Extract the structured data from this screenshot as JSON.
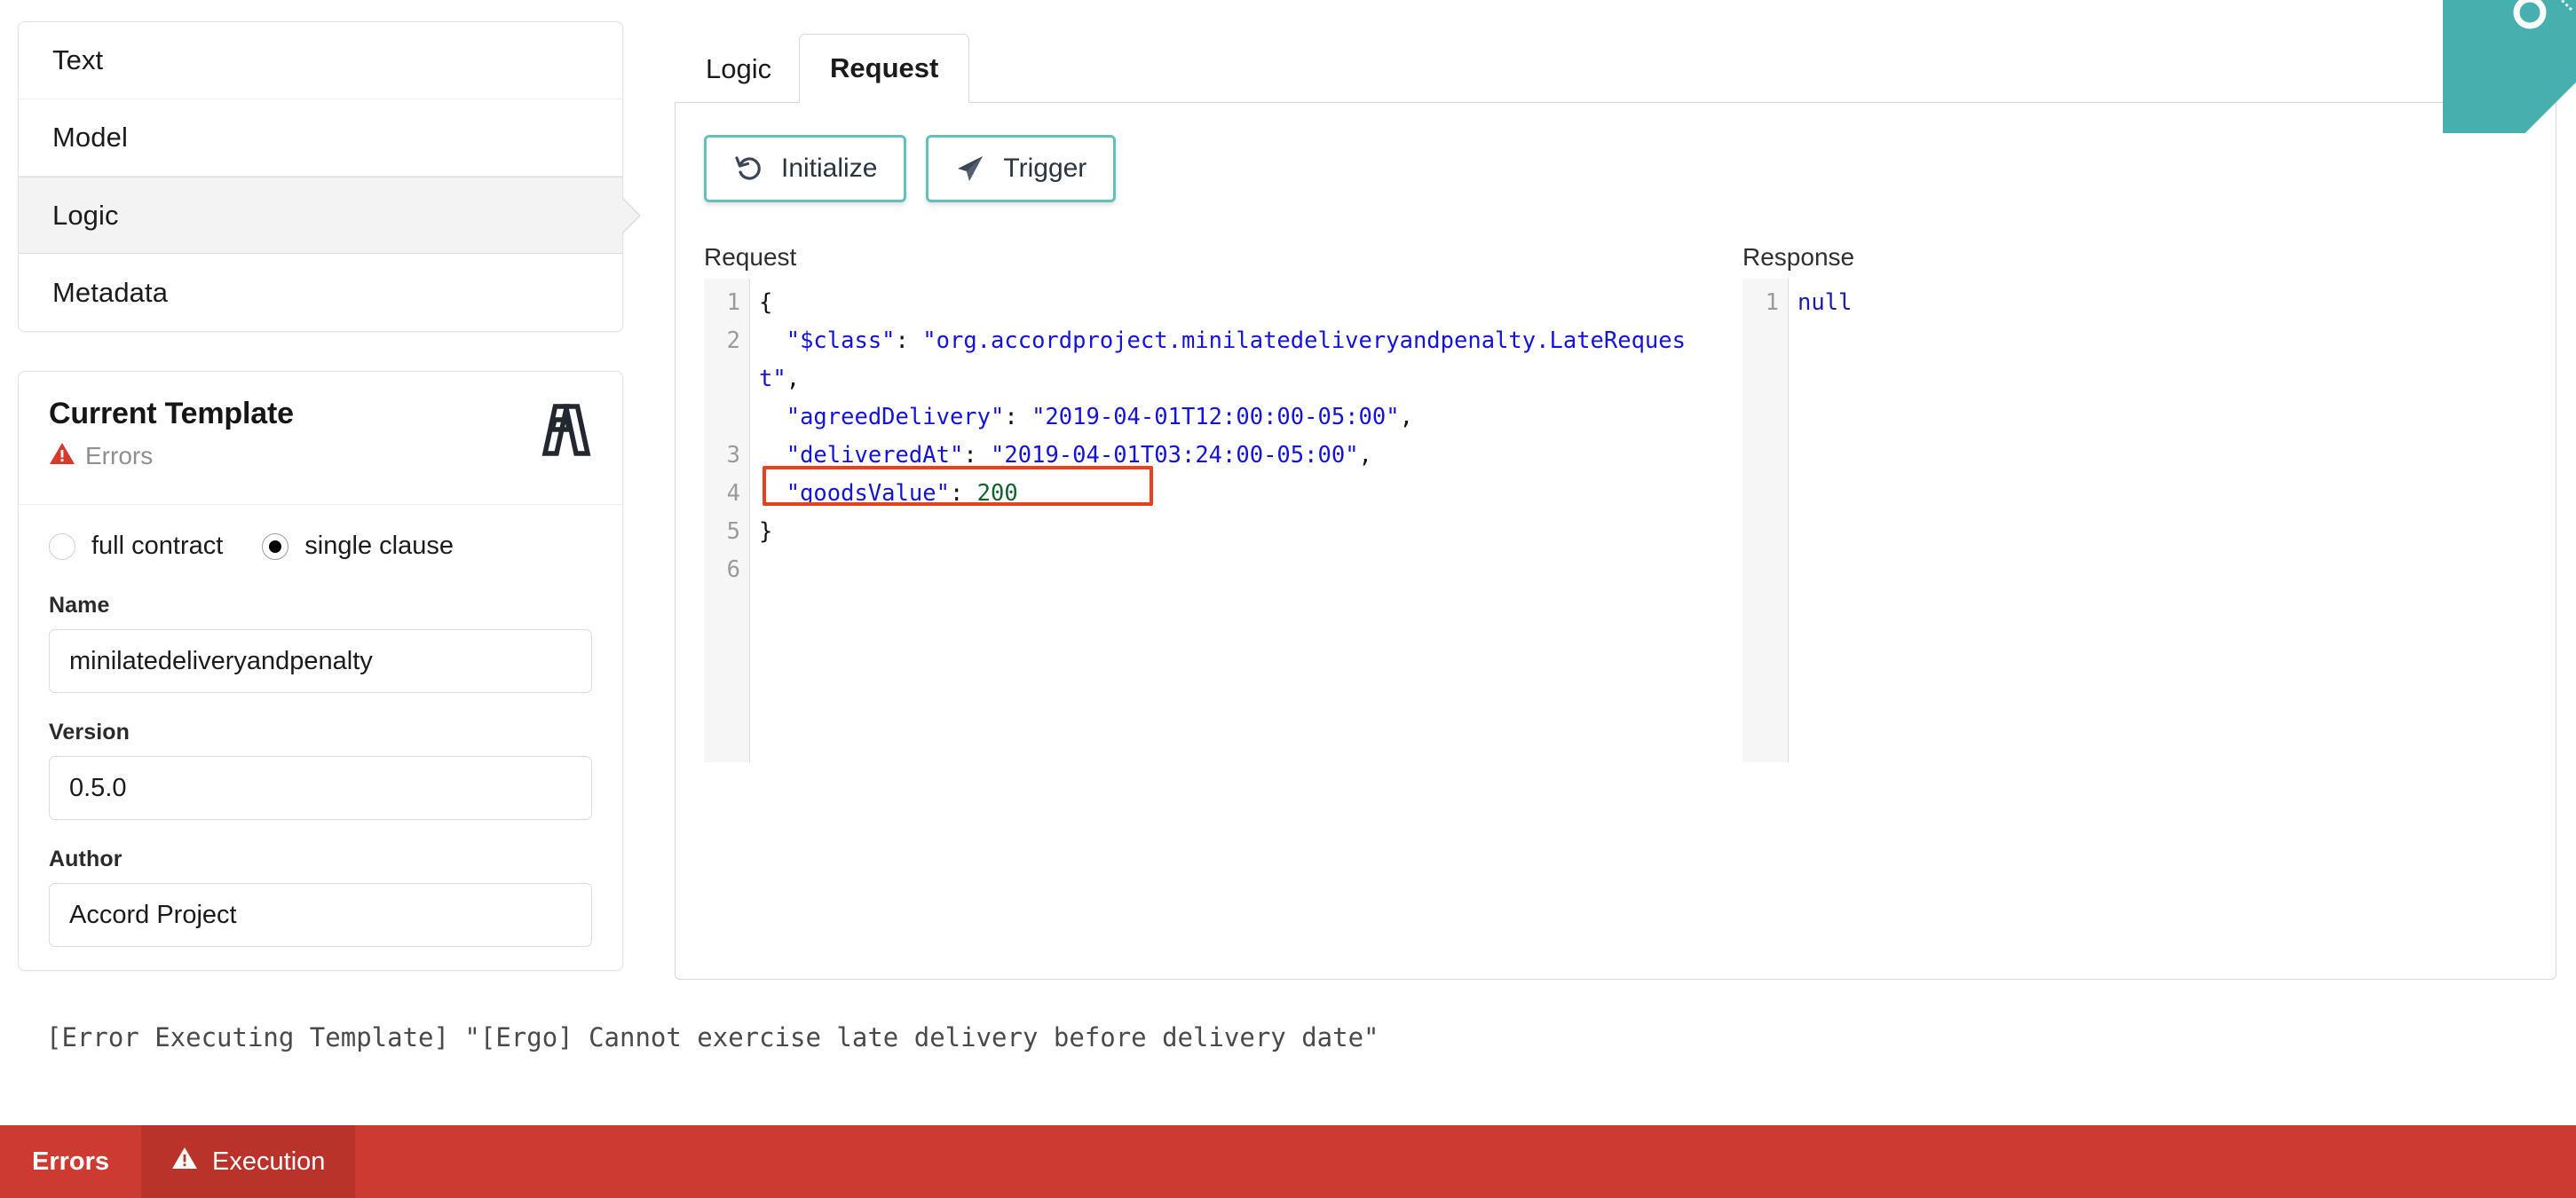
{
  "sidebar": {
    "items": [
      {
        "label": "Text",
        "active": false
      },
      {
        "label": "Model",
        "active": false
      },
      {
        "label": "Logic",
        "active": true
      },
      {
        "label": "Metadata",
        "active": false
      }
    ]
  },
  "current_template": {
    "title": "Current Template",
    "status_label": "Errors",
    "status_color": "#d63a2b",
    "logo_name": "accord-project-logo",
    "mode": {
      "full_contract_label": "full contract",
      "full_contract_selected": false,
      "single_clause_label": "single clause",
      "single_clause_selected": true
    },
    "fields": [
      {
        "label": "Name",
        "value": "minilatedeliveryandpenalty"
      },
      {
        "label": "Version",
        "value": "0.5.0"
      },
      {
        "label": "Author",
        "value": "Accord Project"
      }
    ]
  },
  "main": {
    "tabs": [
      {
        "label": "Logic",
        "active": false
      },
      {
        "label": "Request",
        "active": true
      }
    ],
    "info_icon": "info-icon",
    "actions": [
      {
        "label": "Initialize",
        "icon": "undo-arrow-icon"
      },
      {
        "label": "Trigger",
        "icon": "paper-plane-icon"
      }
    ],
    "accent_color": "#62c0bd",
    "request": {
      "title": "Request",
      "line_numbers": [
        "1",
        "2",
        "3",
        "4",
        "5",
        "6"
      ],
      "lines": [
        {
          "text": "{",
          "type": "punc"
        },
        {
          "text": "  \"$class\": \"org.accordproject.minilatedeliveryandpenalty.LateRequest\",",
          "type": "kv-string"
        },
        {
          "text": "  \"agreedDelivery\": \"2019-04-01T12:00:00-05:00\",",
          "type": "kv-string"
        },
        {
          "text": "  \"deliveredAt\": \"2019-04-01T03:24:00-05:00\",",
          "type": "kv-string",
          "highlighted": true
        },
        {
          "text": "  \"goodsValue\": 200",
          "type": "kv-number"
        },
        {
          "text": "}",
          "type": "punc"
        }
      ],
      "tokens": {
        "l1": "{",
        "l2_key": "\"$class\"",
        "l2_colon": ":",
        "l2_val": "\"org.accordproject.minilatedeliveryandpenalty.LateRequest\"",
        "l2_comma": ",",
        "l3_key": "\"agreedDelivery\"",
        "l3_colon": ": ",
        "l3_val": "\"2019-04-01T12:00:00-05:00\"",
        "l3_comma": ",",
        "l4_key": "\"deliveredAt\"",
        "l4_colon": ": ",
        "l4_val": "\"2019-04-01T03:24:00-05:00\"",
        "l4_comma": ",",
        "l5_key": "\"goodsValue\"",
        "l5_colon": ": ",
        "l5_val": "200",
        "l6": "}"
      },
      "highlight_color": "#e8411f"
    },
    "response": {
      "title": "Response",
      "line_numbers": [
        "1"
      ],
      "value": "null"
    }
  },
  "console": {
    "message": "[Error Executing Template] \"[Ergo] Cannot exercise late delivery before delivery date\""
  },
  "statusbar": {
    "errors_label": "Errors",
    "execution_label": "Execution",
    "execution_icon": "warning-triangle-icon",
    "background_color": "#cd3a31",
    "active_background_color": "#b9332b"
  },
  "ribbon": {
    "name": "corner-ribbon",
    "color": "#48afaf"
  }
}
